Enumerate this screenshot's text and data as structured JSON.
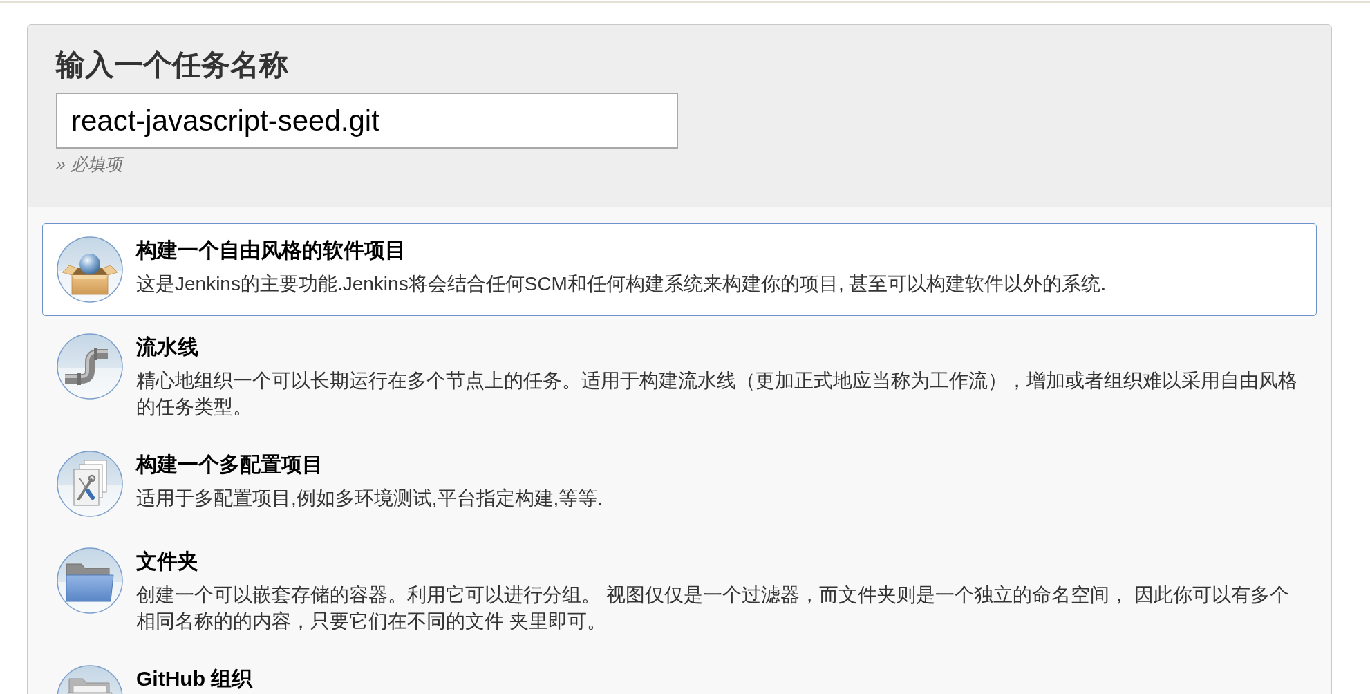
{
  "form": {
    "heading": "输入一个任务名称",
    "name_field": {
      "value": "react-javascript-seed.git"
    },
    "hint": "» 必填项"
  },
  "job_types": [
    {
      "kind": "freestyle",
      "title": "构建一个自由风格的软件项目",
      "description": "这是Jenkins的主要功能.Jenkins将会结合任何SCM和任何构建系统来构建你的项目, 甚至可以构建软件以外的系统.",
      "selected": true
    },
    {
      "kind": "pipeline",
      "title": "流水线",
      "description": "精心地组织一个可以长期运行在多个节点上的任务。适用于构建流水线（更加正式地应当称为工作流），增加或者组织难以采用自由风格的任务类型。",
      "selected": false
    },
    {
      "kind": "matrix",
      "title": "构建一个多配置项目",
      "description": "适用于多配置项目,例如多环境测试,平台指定构建,等等.",
      "selected": false
    },
    {
      "kind": "folder",
      "title": "文件夹",
      "description": "创建一个可以嵌套存储的容器。利用它可以进行分组。 视图仅仅是一个过滤器，而文件夹则是一个独立的命名空间， 因此你可以有多个相同名称的的内容，只要它们在不同的文件 夹里即可。",
      "selected": false
    },
    {
      "kind": "organization",
      "title": "GitHub 组织",
      "selected": false
    }
  ]
}
